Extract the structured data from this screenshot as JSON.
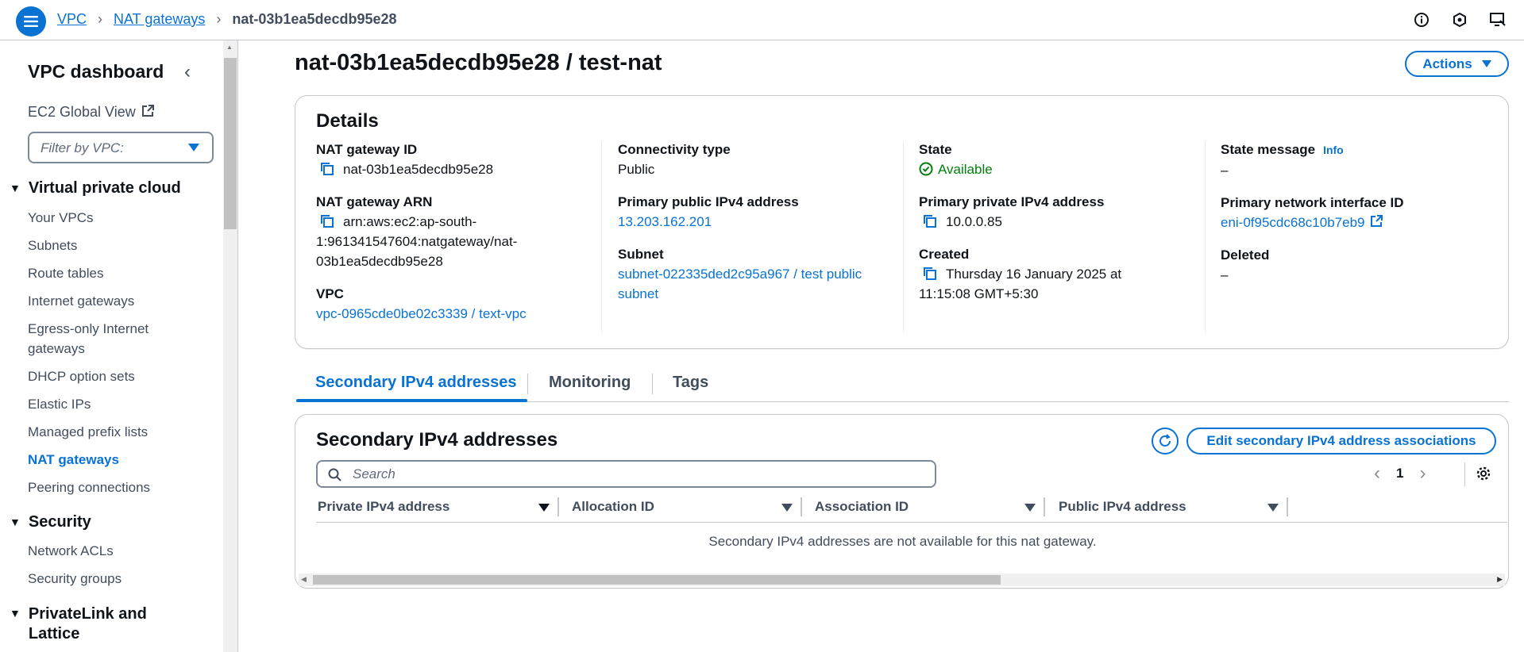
{
  "breadcrumb": {
    "items": [
      "VPC",
      "NAT gateways"
    ],
    "current": "nat-03b1ea5decdb95e28"
  },
  "sidebar": {
    "title": "VPC dashboard",
    "global_view": "EC2 Global View",
    "filter_placeholder": "Filter by VPC:",
    "sections": [
      {
        "title": "Virtual private cloud",
        "items": [
          "Your VPCs",
          "Subnets",
          "Route tables",
          "Internet gateways",
          "Egress-only Internet gateways",
          "DHCP option sets",
          "Elastic IPs",
          "Managed prefix lists",
          "NAT gateways",
          "Peering connections"
        ]
      },
      {
        "title": "Security",
        "items": [
          "Network ACLs",
          "Security groups"
        ]
      },
      {
        "title": "PrivateLink and Lattice",
        "items": []
      }
    ],
    "active_item": "NAT gateways"
  },
  "page": {
    "title": "nat-03b1ea5decdb95e28 / test-nat",
    "actions_label": "Actions"
  },
  "details": {
    "heading": "Details",
    "nat_id_label": "NAT gateway ID",
    "nat_id": "nat-03b1ea5decdb95e28",
    "arn_label": "NAT gateway ARN",
    "arn_line1": "arn:aws:ec2:ap-south-",
    "arn_line2": "1:961341547604:natgateway/nat-",
    "arn_line3": "03b1ea5decdb95e28",
    "vpc_label": "VPC",
    "vpc_value": "vpc-0965cde0be02c3339 / text-vpc",
    "connectivity_label": "Connectivity type",
    "connectivity_value": "Public",
    "public_ip_label": "Primary public IPv4 address",
    "public_ip_value": "13.203.162.201",
    "subnet_label": "Subnet",
    "subnet_line1": "subnet-022335ded2c95a967 / test public",
    "subnet_line2": "subnet",
    "state_label": "State",
    "state_value": "Available",
    "private_ip_label": "Primary private IPv4 address",
    "private_ip_value": "10.0.0.85",
    "created_label": "Created",
    "created_line1": "Thursday 16 January 2025 at",
    "created_line2": "11:15:08 GMT+5:30",
    "state_msg_label": "State message",
    "info_label": "Info",
    "state_msg_value": "–",
    "eni_label": "Primary network interface ID",
    "eni_value": "eni-0f95cdc68c10b7eb9",
    "deleted_label": "Deleted",
    "deleted_value": "–"
  },
  "tabs": [
    "Secondary IPv4 addresses",
    "Monitoring",
    "Tags"
  ],
  "secondary": {
    "title": "Secondary IPv4 addresses",
    "edit_label": "Edit secondary IPv4 address associations",
    "search_placeholder": "Search",
    "page_number": "1",
    "columns": [
      "Private IPv4 address",
      "Allocation ID",
      "Association ID",
      "Public IPv4 address"
    ],
    "empty_message": "Secondary IPv4 addresses are not available for this nat gateway."
  },
  "colors": {
    "accent": "#0972d3",
    "success": "#037f0c",
    "text": "#0f141a"
  }
}
